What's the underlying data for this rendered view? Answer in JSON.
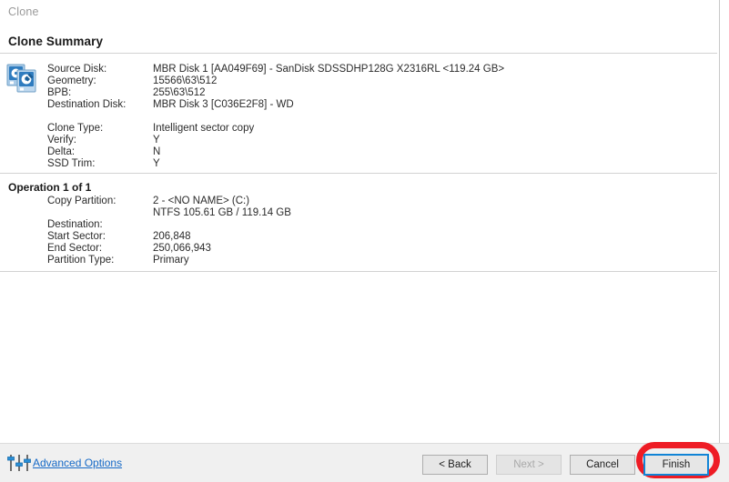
{
  "window": {
    "caption": "Clone",
    "page_title": "Clone Summary"
  },
  "summary": {
    "icon": "disk-clone-icon",
    "disk_rows": [
      {
        "label": "Source Disk:",
        "value": "MBR Disk 1 [AA049F69] - SanDisk SDSSDHP128G X2316RL  <119.24 GB>"
      },
      {
        "label": "Geometry:",
        "value": "15566\\63\\512"
      },
      {
        "label": "BPB:",
        "value": "255\\63\\512"
      },
      {
        "label": "Destination Disk:",
        "value": "MBR Disk 3 [C036E2F8] - WD"
      }
    ],
    "option_rows": [
      {
        "label": "Clone Type:",
        "value": "Intelligent sector copy"
      },
      {
        "label": "Verify:",
        "value": "Y"
      },
      {
        "label": "Delta:",
        "value": "N"
      },
      {
        "label": "SSD Trim:",
        "value": "Y"
      }
    ]
  },
  "operation": {
    "heading": "Operation 1 of 1",
    "rows": [
      {
        "label": "Copy Partition:",
        "value": "2 - <NO NAME> (C:)"
      },
      {
        "label": "",
        "value": "NTFS 105.61 GB / 119.14 GB"
      },
      {
        "label": "Destination:",
        "value": ""
      },
      {
        "label": "Start Sector:",
        "value": "206,848"
      },
      {
        "label": "End Sector:",
        "value": "250,066,943"
      },
      {
        "label": "Partition Type:",
        "value": "Primary"
      }
    ]
  },
  "footer": {
    "advanced_options_label": "Advanced Options",
    "advanced_options_icon": "sliders-icon",
    "buttons": {
      "back": "< Back",
      "next": "Next >",
      "cancel": "Cancel",
      "finish": "Finish"
    }
  },
  "colors": {
    "link": "#1569c7",
    "focus_border": "#1184d6",
    "annotation": "#ee1c25",
    "footer_bg": "#f0f0f0",
    "separator": "#d2d2d2",
    "caption_text": "#9a9a9a"
  }
}
